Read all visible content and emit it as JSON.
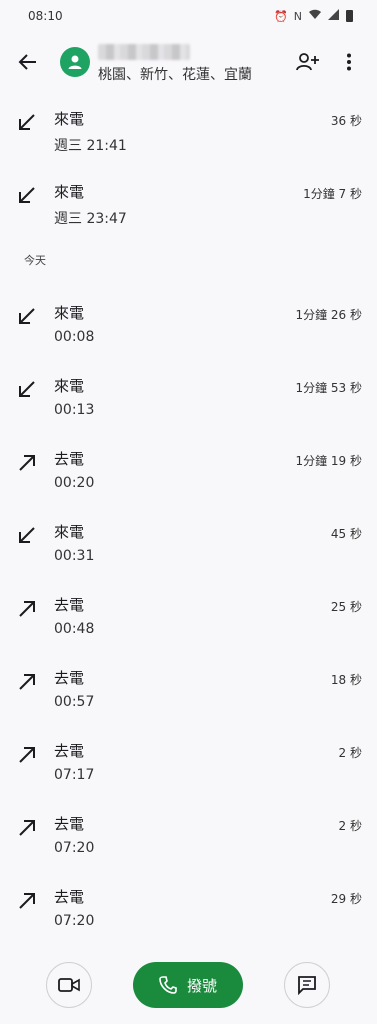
{
  "status_bar": {
    "time": "08:10"
  },
  "header": {
    "location": "桃園、新竹、花蓮、宜蘭"
  },
  "sections": [
    {
      "label": "",
      "items": [
        {
          "direction": "in",
          "type": "來電",
          "time": "週三 21:41",
          "duration": "36 秒"
        },
        {
          "direction": "in",
          "type": "來電",
          "time": "週三 23:47",
          "duration": "1分鐘 7 秒"
        }
      ]
    },
    {
      "label": "今天",
      "items": [
        {
          "direction": "in",
          "type": "來電",
          "time": "00:08",
          "duration": "1分鐘 26 秒"
        },
        {
          "direction": "in",
          "type": "來電",
          "time": "00:13",
          "duration": "1分鐘 53 秒"
        },
        {
          "direction": "out",
          "type": "去電",
          "time": "00:20",
          "duration": "1分鐘 19 秒"
        },
        {
          "direction": "in",
          "type": "來電",
          "time": "00:31",
          "duration": "45 秒"
        },
        {
          "direction": "out",
          "type": "去電",
          "time": "00:48",
          "duration": "25 秒"
        },
        {
          "direction": "out",
          "type": "去電",
          "time": "00:57",
          "duration": "18 秒"
        },
        {
          "direction": "out",
          "type": "去電",
          "time": "07:17",
          "duration": "2 秒"
        },
        {
          "direction": "out",
          "type": "去電",
          "time": "07:20",
          "duration": "2 秒"
        },
        {
          "direction": "out",
          "type": "去電",
          "time": "07:20",
          "duration": "29 秒"
        }
      ]
    }
  ],
  "bottom": {
    "dial_label": "撥號"
  },
  "colors": {
    "accent": "#1a8a3d",
    "avatar": "#1ea362",
    "background": "#f8f7fa"
  }
}
